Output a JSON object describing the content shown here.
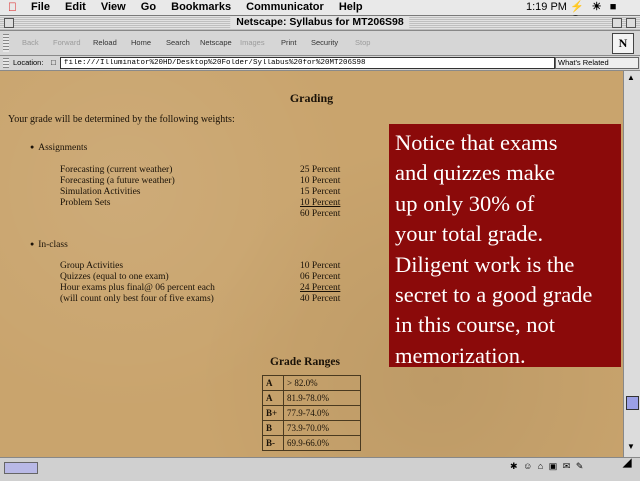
{
  "menubar": {
    "menus": [
      "File",
      "Edit",
      "View",
      "Go",
      "Bookmarks",
      "Communicator",
      "Help"
    ],
    "clock": "1:19 PM",
    "tray_icons": [
      "⚡",
      "☀",
      "■",
      "Ⓝ"
    ]
  },
  "window": {
    "title": "Netscape: Syllabus for MT206S98"
  },
  "toolbar": {
    "back": "Back",
    "forward": "Forward",
    "reload": "Reload",
    "home": "Home",
    "search": "Search",
    "netscape": "Netscape",
    "images": "Images",
    "print": "Print",
    "security": "Security",
    "stop": "Stop",
    "logo": "N"
  },
  "location": {
    "label": "Location:",
    "url": "file:///Illuminator%20HD/Desktop%20Folder/Syllabus%20for%20MT206S98",
    "related": "What's Related"
  },
  "page": {
    "heading": "Grading",
    "intro": "Your grade will be determined by the following weights:",
    "assignments": {
      "title": "Assignments",
      "rows": [
        {
          "label": "Forecasting (current weather)",
          "value": "25 Percent"
        },
        {
          "label": "Forecasting (a future weather)",
          "value": "10 Percent"
        },
        {
          "label": "Simulation Activities",
          "value": "15 Percent"
        },
        {
          "label": "Problem Sets",
          "value": "10 Percent"
        }
      ],
      "total": "60 Percent"
    },
    "inclass": {
      "title": "In-class",
      "rows": [
        {
          "label": "Group Activities",
          "value": "10 Percent"
        },
        {
          "label": "Quizzes (equal to one exam)",
          "value": "06 Percent"
        },
        {
          "label": "Hour exams plus final@ 06 percent each",
          "value": "24 Percent"
        },
        {
          "label": "(will count only best four of five exams)",
          "value": "40 Percent"
        }
      ]
    },
    "ranges_title": "Grade Ranges",
    "ranges": [
      {
        "grade": "A",
        "range": "> 82.0%"
      },
      {
        "grade": "A",
        "range": "81.9-78.0%"
      },
      {
        "grade": "B+",
        "range": "77.9-74.0%"
      },
      {
        "grade": "B",
        "range": "73.9-70.0%"
      },
      {
        "grade": "B-",
        "range": "69.9-66.0%"
      }
    ]
  },
  "callout": {
    "lines": [
      "Notice that exams",
      "and quizzes make",
      "up only 30% of",
      "your total grade.",
      "Diligent work is the",
      "secret to a good grade",
      "in this course, not",
      "memorization."
    ]
  },
  "statusbar": {
    "tray_icons": [
      "✱",
      "☺",
      "⌂",
      "▣",
      "✉",
      "✎"
    ]
  }
}
